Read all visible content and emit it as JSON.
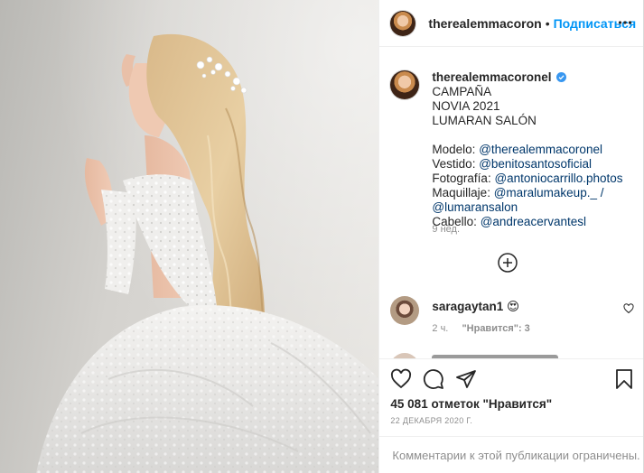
{
  "post": {
    "image_alt": "Bride in lace wedding dress with long blonde wavy hair and floral hair clip",
    "header": {
      "username": "therealemmacoron",
      "separator": "•",
      "follow_label": "Подписаться",
      "more_icon": "more-horizontal-icon"
    },
    "caption": {
      "username": "therealemmacoronel",
      "verified_icon": "verified-badge-icon",
      "title_line1": "CAMPAÑA",
      "title_line2": "NOVIA 2021",
      "title_line3": "LUMARAN SALÓN",
      "credits": [
        {
          "label": "Modelo: ",
          "handle": "@therealemmacoronel"
        },
        {
          "label": "Vestido: ",
          "handle": "@benitosantosoficial"
        },
        {
          "label": "Fotografía: ",
          "handle": "@antoniocarrillo.photos"
        },
        {
          "label": "Maquillaje: ",
          "handle": "@maralumakeup._ /"
        },
        {
          "label": "",
          "handle": "@lumaransalon"
        },
        {
          "label": "Cabello: ",
          "handle": "@andreacervantesl"
        }
      ],
      "time": "9 нед."
    },
    "load_more_icon": "plus-circle-icon",
    "comment": {
      "username": "saragaytan1",
      "text": "😍",
      "time": "2 ч.",
      "likes": "\"Нравится\": 3",
      "like_icon": "heart-outline-icon"
    },
    "actions": {
      "like_icon": "heart-outline-icon",
      "comment_icon": "comment-bubble-icon",
      "share_icon": "paper-plane-icon",
      "save_icon": "bookmark-icon"
    },
    "likes_text": "45 081 отметок \"Нравится\"",
    "date": "22 декабря 2020 г.",
    "comments_limited": "Комментарии к этой публикации ограничены."
  },
  "colors": {
    "link": "#00376b",
    "follow": "#0095f6",
    "verified": "#3897f0",
    "secondary_text": "#8e8e8e",
    "border": "#efefef"
  }
}
